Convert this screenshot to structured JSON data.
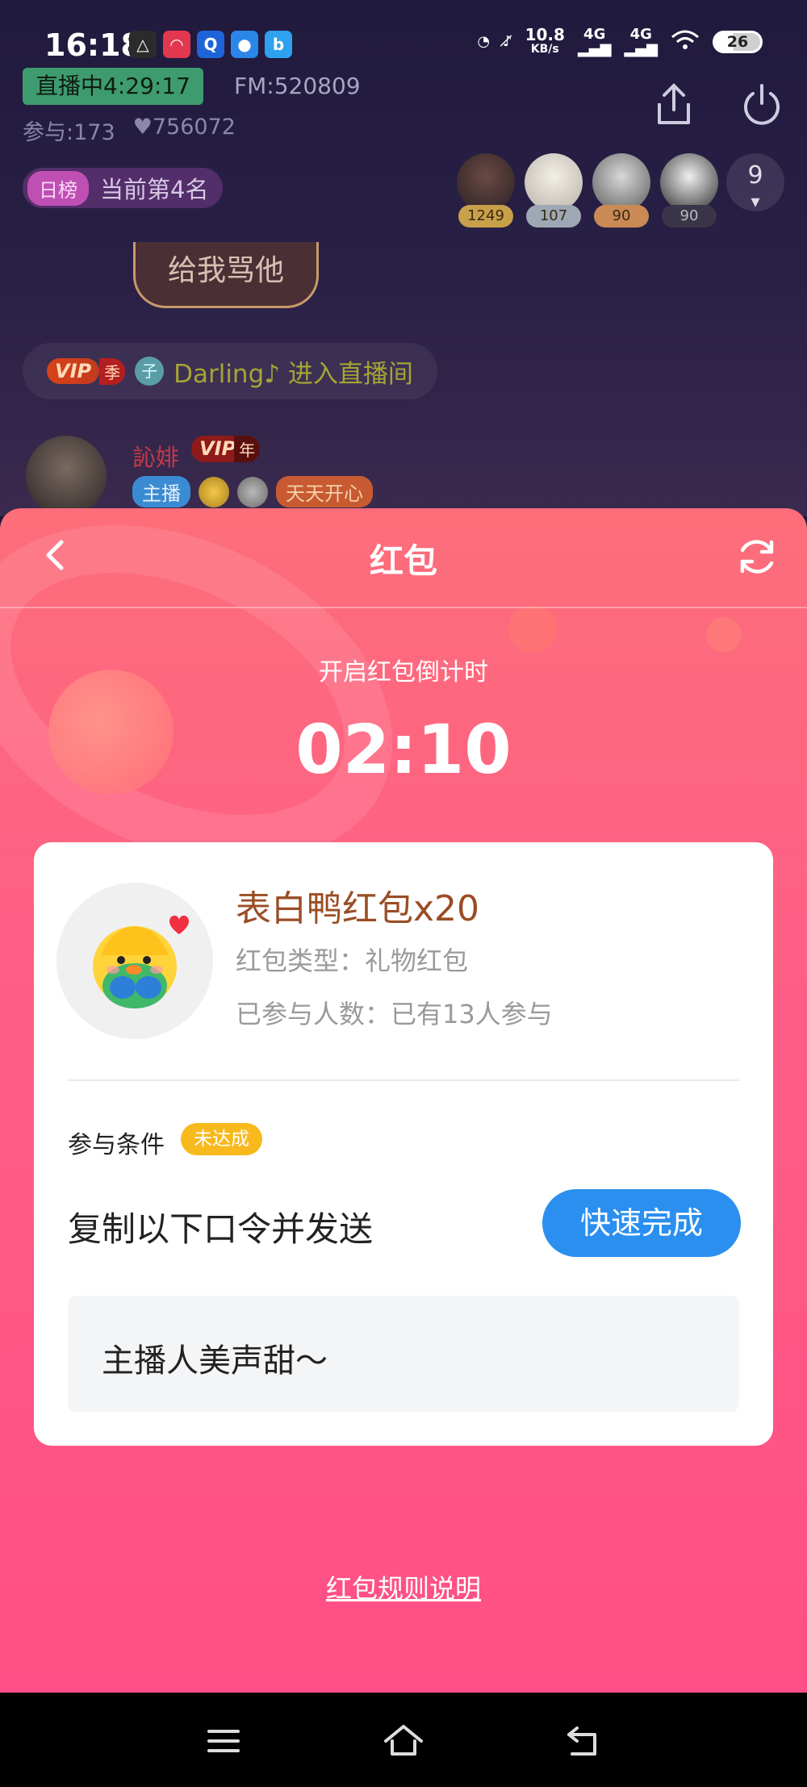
{
  "status_bar": {
    "time": "16:18",
    "net_speed": "10.8",
    "net_unit": "KB/s",
    "signal1": "4G",
    "signal2": "4G",
    "battery": "26"
  },
  "room": {
    "live_status": "直播中4:29:17",
    "fm": "FM:520809",
    "participants": "参与:173",
    "likes": "756072",
    "rank_tag": "日榜",
    "rank_text": "当前第4名",
    "viewer_scores": [
      "1249",
      "107",
      "90",
      "90"
    ],
    "viewer_more": "9",
    "chat_bubble": "给我骂他",
    "enter_vip": "VIP",
    "enter_vip_tier": "季",
    "enter_badge": "子",
    "enter_message": "Darling♪ 进入直播间",
    "user_name": "訫婔",
    "user_vip": "VIP",
    "user_vip_tier": "年",
    "user_tag_host": "主播",
    "user_tag_happy": "天天开心"
  },
  "red_packet": {
    "title": "红包",
    "countdown_label": "开启红包倒计时",
    "countdown": "02:10",
    "gift_name": "表白鸭红包x20",
    "gift_type": "红包类型：礼物红包",
    "participants": "已参与人数：已有13人参与",
    "condition_label": "参与条件",
    "condition_status": "未达成",
    "condition_desc": "复制以下口令并发送",
    "quick_button": "快速完成",
    "password": "主播人美声甜～",
    "rules_link": "红包规则说明"
  },
  "colors": {
    "sheet_top": "#fd6e7a",
    "sheet_bottom": "#ff4f86",
    "gift_name": "#9a4d24",
    "badge_yellow": "#f8b91d",
    "button_blue": "#2b8fef"
  }
}
